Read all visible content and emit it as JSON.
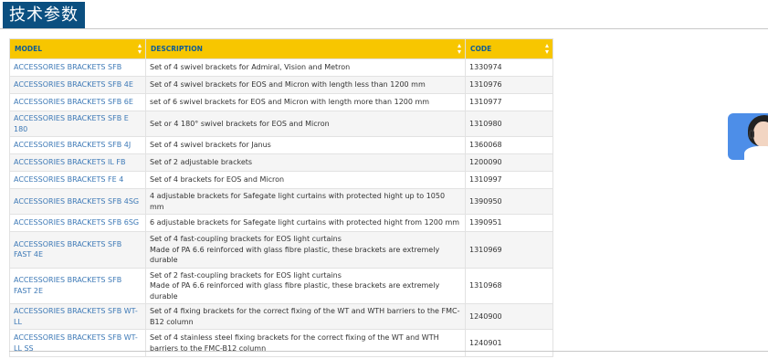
{
  "section": {
    "title": "技术参数"
  },
  "table": {
    "headers": {
      "model": "MODEL",
      "description": "DESCRIPTION",
      "code": "CODE"
    },
    "rows": [
      {
        "model": "ACCESSORIES BRACKETS SFB",
        "desc": [
          "Set of 4 swivel brackets for Admiral, Vision and Metron"
        ],
        "code": "1330974"
      },
      {
        "model": "ACCESSORIES BRACKETS SFB 4E",
        "desc": [
          "Set of 4 swivel brackets for EOS and Micron with length less than 1200 mm"
        ],
        "code": "1310976"
      },
      {
        "model": "ACCESSORIES BRACKETS SFB 6E",
        "desc": [
          "set of 6 swivel brackets for EOS and Micron with length more than 1200 mm"
        ],
        "code": "1310977"
      },
      {
        "model": "ACCESSORIES BRACKETS SFB E 180",
        "desc": [
          "Set or 4 180° swivel brackets for EOS and Micron"
        ],
        "code": "1310980"
      },
      {
        "model": "ACCESSORIES BRACKETS SFB 4J",
        "desc": [
          "Set of 4 swivel brackets for Janus"
        ],
        "code": "1360068"
      },
      {
        "model": "ACCESSORIES BRACKETS IL FB",
        "desc": [
          "Set of 2 adjustable brackets"
        ],
        "code": "1200090"
      },
      {
        "model": "ACCESSORIES BRACKETS FE 4",
        "desc": [
          "Set of 4 brackets for EOS and Micron"
        ],
        "code": "1310997"
      },
      {
        "model": "ACCESSORIES BRACKETS SFB 4SG",
        "desc": [
          "4 adjustable brackets for Safegate light curtains with protected hight up to 1050 mm"
        ],
        "code": "1390950"
      },
      {
        "model": "ACCESSORIES BRACKETS SFB 6SG",
        "desc": [
          "6 adjustable brackets for Safegate light curtains with protected hight from 1200 mm"
        ],
        "code": "1390951"
      },
      {
        "model": "ACCESSORIES BRACKETS SFB FAST 4E",
        "desc": [
          "Set of 4 fast-coupling brackets for EOS light curtains",
          "Made of PA 6.6 reinforced with glass fibre plastic, these brackets are extremely durable"
        ],
        "code": "1310969"
      },
      {
        "model": "ACCESSORIES BRACKETS SFB FAST 2E",
        "desc": [
          "Set of 2 fast-coupling brackets for EOS light curtains",
          "Made of PA 6.6 reinforced with glass fibre plastic, these brackets are extremely durable"
        ],
        "code": "1310968"
      },
      {
        "model": "ACCESSORIES BRACKETS SFB WT-LL",
        "desc": [
          "Set of 4 fixing brackets for the correct fixing of the WT and WTH barriers to the FMC-B12 column"
        ],
        "code": "1240900"
      },
      {
        "model": "ACCESSORIES BRACKETS SFB WT-LL SS",
        "desc": [
          "Set of 4 stainless steel fixing brackets for the correct fixing of the WT and WTH barriers to the FMC-B12 column"
        ],
        "code": "1240901"
      }
    ]
  },
  "colors": {
    "header_bg": "#0b4f80",
    "table_header_bg": "#f7c600",
    "link": "#3d79b6"
  }
}
